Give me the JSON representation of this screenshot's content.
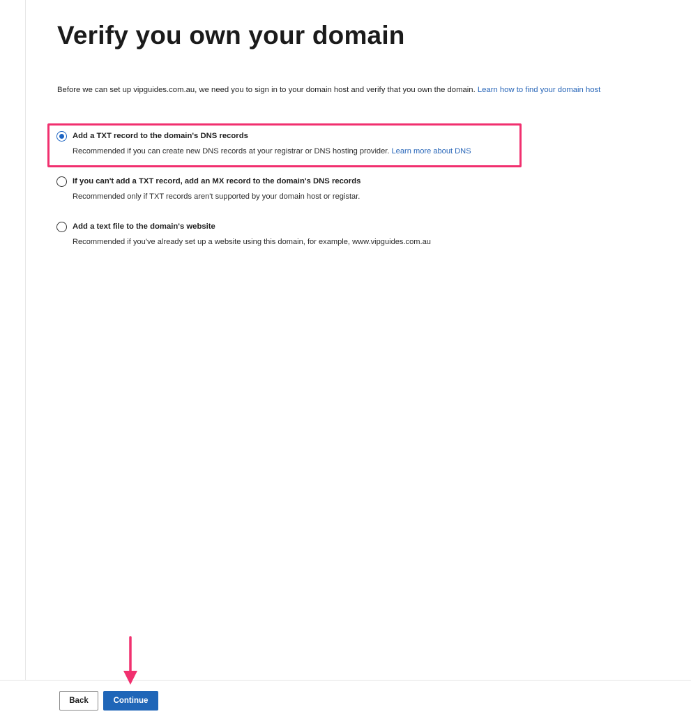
{
  "page": {
    "title": "Verify you own your domain",
    "intro_text": "Before we can set up vipguides.com.au, we need you to sign in to your domain host and verify that you own the domain. ",
    "intro_link": "Learn how to find your domain host"
  },
  "options": [
    {
      "label": "Add a TXT record to the domain's DNS records",
      "description": "Recommended if you can create new DNS records at your registrar or DNS hosting provider. ",
      "link": "Learn more about DNS",
      "selected": true
    },
    {
      "label": "If you can't add a TXT record, add an MX record to the domain's DNS records",
      "description": "Recommended only if TXT records aren't supported by your domain host or registar.",
      "selected": false
    },
    {
      "label": "Add a text file to the domain's website",
      "description": "Recommended if you've already set up a website using this domain, for example, www.vipguides.com.au",
      "selected": false
    }
  ],
  "footer": {
    "back_label": "Back",
    "continue_label": "Continue"
  },
  "colors": {
    "accent": "#1f66b8",
    "link": "#2765b8",
    "annotation": "#f1306f"
  },
  "icons": {
    "annotation_arrow": "arrow-down-icon"
  }
}
